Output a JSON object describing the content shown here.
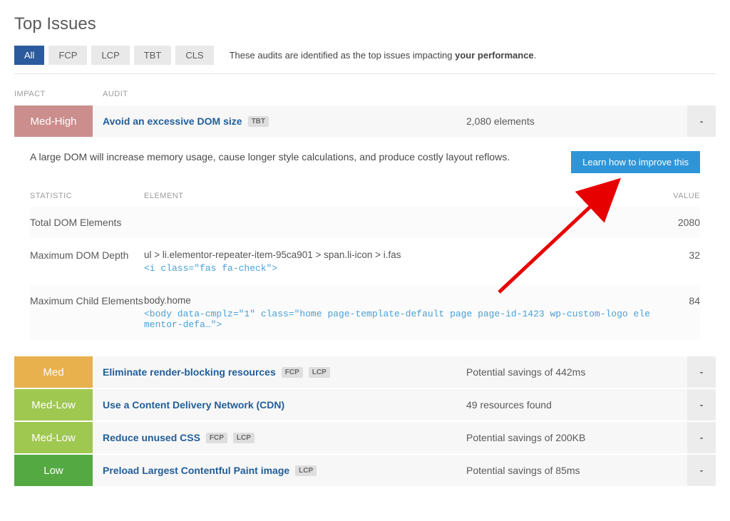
{
  "title": "Top Issues",
  "tabs": {
    "items": [
      "All",
      "FCP",
      "LCP",
      "TBT",
      "CLS"
    ],
    "active": 0,
    "note_prefix": "These audits are identified as the top issues impacting ",
    "note_strong": "your performance",
    "note_suffix": "."
  },
  "columns": {
    "impact": "IMPACT",
    "audit": "AUDIT"
  },
  "expanded_issue": {
    "impact_label": "Med-High",
    "audit_name": "Avoid an excessive DOM size",
    "metric_tags": [
      "TBT"
    ],
    "value_text": "2,080 elements",
    "description": "A large DOM will increase memory usage, cause longer style calculations, and produce costly layout reflows.",
    "learn_button": "Learn how to improve this",
    "stat_headers": {
      "statistic": "STATISTIC",
      "element": "ELEMENT",
      "value": "VALUE"
    },
    "stats": [
      {
        "stat": "Total DOM Elements",
        "elem_path": "",
        "elem_code": "",
        "value": "2080"
      },
      {
        "stat": "Maximum DOM Depth",
        "elem_path": "ul > li.elementor-repeater-item-95ca901 > span.li-icon > i.fas",
        "elem_code": "<i class=\"fas fa-check\">",
        "value": "32"
      },
      {
        "stat": "Maximum Child Elements",
        "elem_path": "body.home",
        "elem_code": "<body data-cmplz=\"1\" class=\"home page-template-default page page-id-1423 wp-custom-logo elementor-defa…\">",
        "value": "84"
      }
    ]
  },
  "collapsed_issues": [
    {
      "impact_label": "Med",
      "impact_class": "impact-med",
      "audit_name": "Eliminate render-blocking resources",
      "metric_tags": [
        "FCP",
        "LCP"
      ],
      "value_text": "Potential savings of 442ms"
    },
    {
      "impact_label": "Med-Low",
      "impact_class": "impact-medlow",
      "audit_name": "Use a Content Delivery Network (CDN)",
      "metric_tags": [],
      "value_text": "49 resources found"
    },
    {
      "impact_label": "Med-Low",
      "impact_class": "impact-medlow",
      "audit_name": "Reduce unused CSS",
      "metric_tags": [
        "FCP",
        "LCP"
      ],
      "value_text": "Potential savings of 200KB"
    },
    {
      "impact_label": "Low",
      "impact_class": "impact-low",
      "audit_name": "Preload Largest Contentful Paint image",
      "metric_tags": [
        "LCP"
      ],
      "value_text": "Potential savings of 85ms"
    }
  ]
}
